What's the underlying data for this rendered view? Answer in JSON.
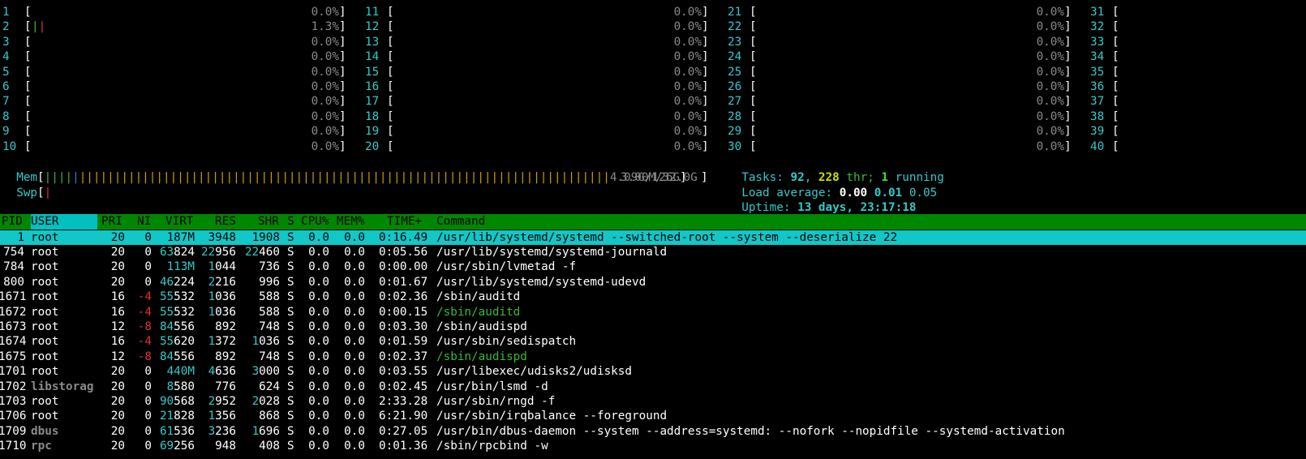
{
  "cpus": [
    {
      "id": "1",
      "pct": "0.0%"
    },
    {
      "id": "2",
      "pct": "1.3%",
      "ticks": "||"
    },
    {
      "id": "3",
      "pct": "0.0%"
    },
    {
      "id": "4",
      "pct": "0.0%"
    },
    {
      "id": "5",
      "pct": "0.0%"
    },
    {
      "id": "6",
      "pct": "0.0%"
    },
    {
      "id": "7",
      "pct": "0.0%"
    },
    {
      "id": "8",
      "pct": "0.0%"
    },
    {
      "id": "9",
      "pct": "0.0%"
    },
    {
      "id": "10",
      "pct": "0.0%"
    },
    {
      "id": "11",
      "pct": "0.0%"
    },
    {
      "id": "12",
      "pct": "0.0%"
    },
    {
      "id": "13",
      "pct": "0.0%"
    },
    {
      "id": "14",
      "pct": "0.0%"
    },
    {
      "id": "15",
      "pct": "0.0%"
    },
    {
      "id": "16",
      "pct": "0.0%"
    },
    {
      "id": "17",
      "pct": "0.0%"
    },
    {
      "id": "18",
      "pct": "0.0%"
    },
    {
      "id": "19",
      "pct": "0.0%"
    },
    {
      "id": "20",
      "pct": "0.0%"
    },
    {
      "id": "21",
      "pct": "0.0%"
    },
    {
      "id": "22",
      "pct": "0.0%"
    },
    {
      "id": "23",
      "pct": "0.0%"
    },
    {
      "id": "24",
      "pct": "0.0%"
    },
    {
      "id": "25",
      "pct": "0.0%"
    },
    {
      "id": "26",
      "pct": "0.0%"
    },
    {
      "id": "27",
      "pct": "0.0%"
    },
    {
      "id": "28",
      "pct": "0.0%"
    },
    {
      "id": "29",
      "pct": "0.0%"
    },
    {
      "id": "30",
      "pct": "0.0%"
    },
    {
      "id": "31",
      "pct": ""
    },
    {
      "id": "32",
      "pct": ""
    },
    {
      "id": "33",
      "pct": ""
    },
    {
      "id": "34",
      "pct": ""
    },
    {
      "id": "35",
      "pct": ""
    },
    {
      "id": "36",
      "pct": ""
    },
    {
      "id": "37",
      "pct": ""
    },
    {
      "id": "38",
      "pct": ""
    },
    {
      "id": "39",
      "pct": ""
    },
    {
      "id": "40",
      "pct": ""
    }
  ],
  "mem": {
    "label": "Mem",
    "value": "4.09G/126G",
    "fill": 0.93
  },
  "swp": {
    "label": "Swp",
    "value": "3.00M/32.0G",
    "fill": 0.0001
  },
  "tasks": {
    "label": "Tasks:",
    "count": "92",
    "sep1": ",",
    "threads": "228",
    "thr": "thr;",
    "running": "1",
    "running_label": "running"
  },
  "load": {
    "label": "Load average:",
    "l1": "0.00",
    "l5": "0.01",
    "l15": "0.05"
  },
  "uptime": {
    "label": "Uptime:",
    "value": "13 days, 23:17:18"
  },
  "header": {
    "pid": "PID",
    "user": "USER",
    "pri": "PRI",
    "ni": "NI",
    "virt": "VIRT",
    "res": "RES",
    "shr": "SHR",
    "s": "S",
    "cpu": "CPU%",
    "mem": "MEM%",
    "time": "TIME+",
    "cmd": "Command"
  },
  "processes": [
    {
      "pid": "1",
      "user": "root",
      "pri": "20",
      "ni": "0",
      "virt": "187M",
      "res": "3948",
      "shr": "1908",
      "s": "S",
      "cpu": "0.0",
      "mem": "0.0",
      "time": "0:16.49",
      "cmd": "/usr/lib/systemd/systemd --switched-root --system --deserialize 22",
      "selected": true
    },
    {
      "pid": "754",
      "user": "root",
      "pri": "20",
      "ni": "0",
      "virt": "63824",
      "res": "22956",
      "shr": "22460",
      "s": "S",
      "cpu": "0.0",
      "mem": "0.0",
      "time": "0:05.56",
      "cmd": "/usr/lib/systemd/systemd-journald"
    },
    {
      "pid": "784",
      "user": "root",
      "pri": "20",
      "ni": "0",
      "virt": "113M",
      "res": "1044",
      "shr": "736",
      "s": "S",
      "cpu": "0.0",
      "mem": "0.0",
      "time": "0:00.00",
      "cmd": "/usr/sbin/lvmetad -f"
    },
    {
      "pid": "800",
      "user": "root",
      "pri": "20",
      "ni": "0",
      "virt": "46224",
      "res": "2216",
      "shr": "996",
      "s": "S",
      "cpu": "0.0",
      "mem": "0.0",
      "time": "0:01.67",
      "cmd": "/usr/lib/systemd/systemd-udevd"
    },
    {
      "pid": "1671",
      "user": "root",
      "pri": "16",
      "ni": "-4",
      "virt": "55532",
      "res": "1036",
      "shr": "588",
      "s": "S",
      "cpu": "0.0",
      "mem": "0.0",
      "time": "0:02.36",
      "cmd": "/sbin/auditd"
    },
    {
      "pid": "1672",
      "user": "root",
      "pri": "16",
      "ni": "-4",
      "virt": "55532",
      "res": "1036",
      "shr": "588",
      "s": "S",
      "cpu": "0.0",
      "mem": "0.0",
      "time": "0:00.15",
      "cmd": "/sbin/auditd",
      "thread": true
    },
    {
      "pid": "1673",
      "user": "root",
      "pri": "12",
      "ni": "-8",
      "virt": "84556",
      "res": "892",
      "shr": "748",
      "s": "S",
      "cpu": "0.0",
      "mem": "0.0",
      "time": "0:03.30",
      "cmd": "/sbin/audispd"
    },
    {
      "pid": "1674",
      "user": "root",
      "pri": "16",
      "ni": "-4",
      "virt": "55620",
      "res": "1372",
      "shr": "1036",
      "s": "S",
      "cpu": "0.0",
      "mem": "0.0",
      "time": "0:01.59",
      "cmd": "/usr/sbin/sedispatch"
    },
    {
      "pid": "1675",
      "user": "root",
      "pri": "12",
      "ni": "-8",
      "virt": "84556",
      "res": "892",
      "shr": "748",
      "s": "S",
      "cpu": "0.0",
      "mem": "0.0",
      "time": "0:02.37",
      "cmd": "/sbin/audispd",
      "thread": true
    },
    {
      "pid": "1701",
      "user": "root",
      "pri": "20",
      "ni": "0",
      "virt": "440M",
      "res": "4636",
      "shr": "3000",
      "s": "S",
      "cpu": "0.0",
      "mem": "0.0",
      "time": "0:03.55",
      "cmd": "/usr/libexec/udisks2/udisksd"
    },
    {
      "pid": "1702",
      "user": "libstorag",
      "pri": "20",
      "ni": "0",
      "virt": "8580",
      "res": "776",
      "shr": "624",
      "s": "S",
      "cpu": "0.0",
      "mem": "0.0",
      "time": "0:02.45",
      "cmd": "/usr/bin/lsmd -d",
      "dimuser": true
    },
    {
      "pid": "1703",
      "user": "root",
      "pri": "20",
      "ni": "0",
      "virt": "90568",
      "res": "2952",
      "shr": "2028",
      "s": "S",
      "cpu": "0.0",
      "mem": "0.0",
      "time": "2:33.28",
      "cmd": "/usr/sbin/rngd -f"
    },
    {
      "pid": "1706",
      "user": "root",
      "pri": "20",
      "ni": "0",
      "virt": "21828",
      "res": "1356",
      "shr": "868",
      "s": "S",
      "cpu": "0.0",
      "mem": "0.0",
      "time": "6:21.90",
      "cmd": "/usr/sbin/irqbalance --foreground"
    },
    {
      "pid": "1709",
      "user": "dbus",
      "pri": "20",
      "ni": "0",
      "virt": "61536",
      "res": "3236",
      "shr": "1696",
      "s": "S",
      "cpu": "0.0",
      "mem": "0.0",
      "time": "0:27.05",
      "cmd": "/usr/bin/dbus-daemon --system --address=systemd: --nofork --nopidfile --systemd-activation",
      "dimuser": true
    },
    {
      "pid": "1710",
      "user": "rpc",
      "pri": "20",
      "ni": "0",
      "virt": "69256",
      "res": "948",
      "shr": "408",
      "s": "S",
      "cpu": "0.0",
      "mem": "0.0",
      "time": "0:01.36",
      "cmd": "/sbin/rpcbind -w",
      "dimuser": true
    }
  ]
}
